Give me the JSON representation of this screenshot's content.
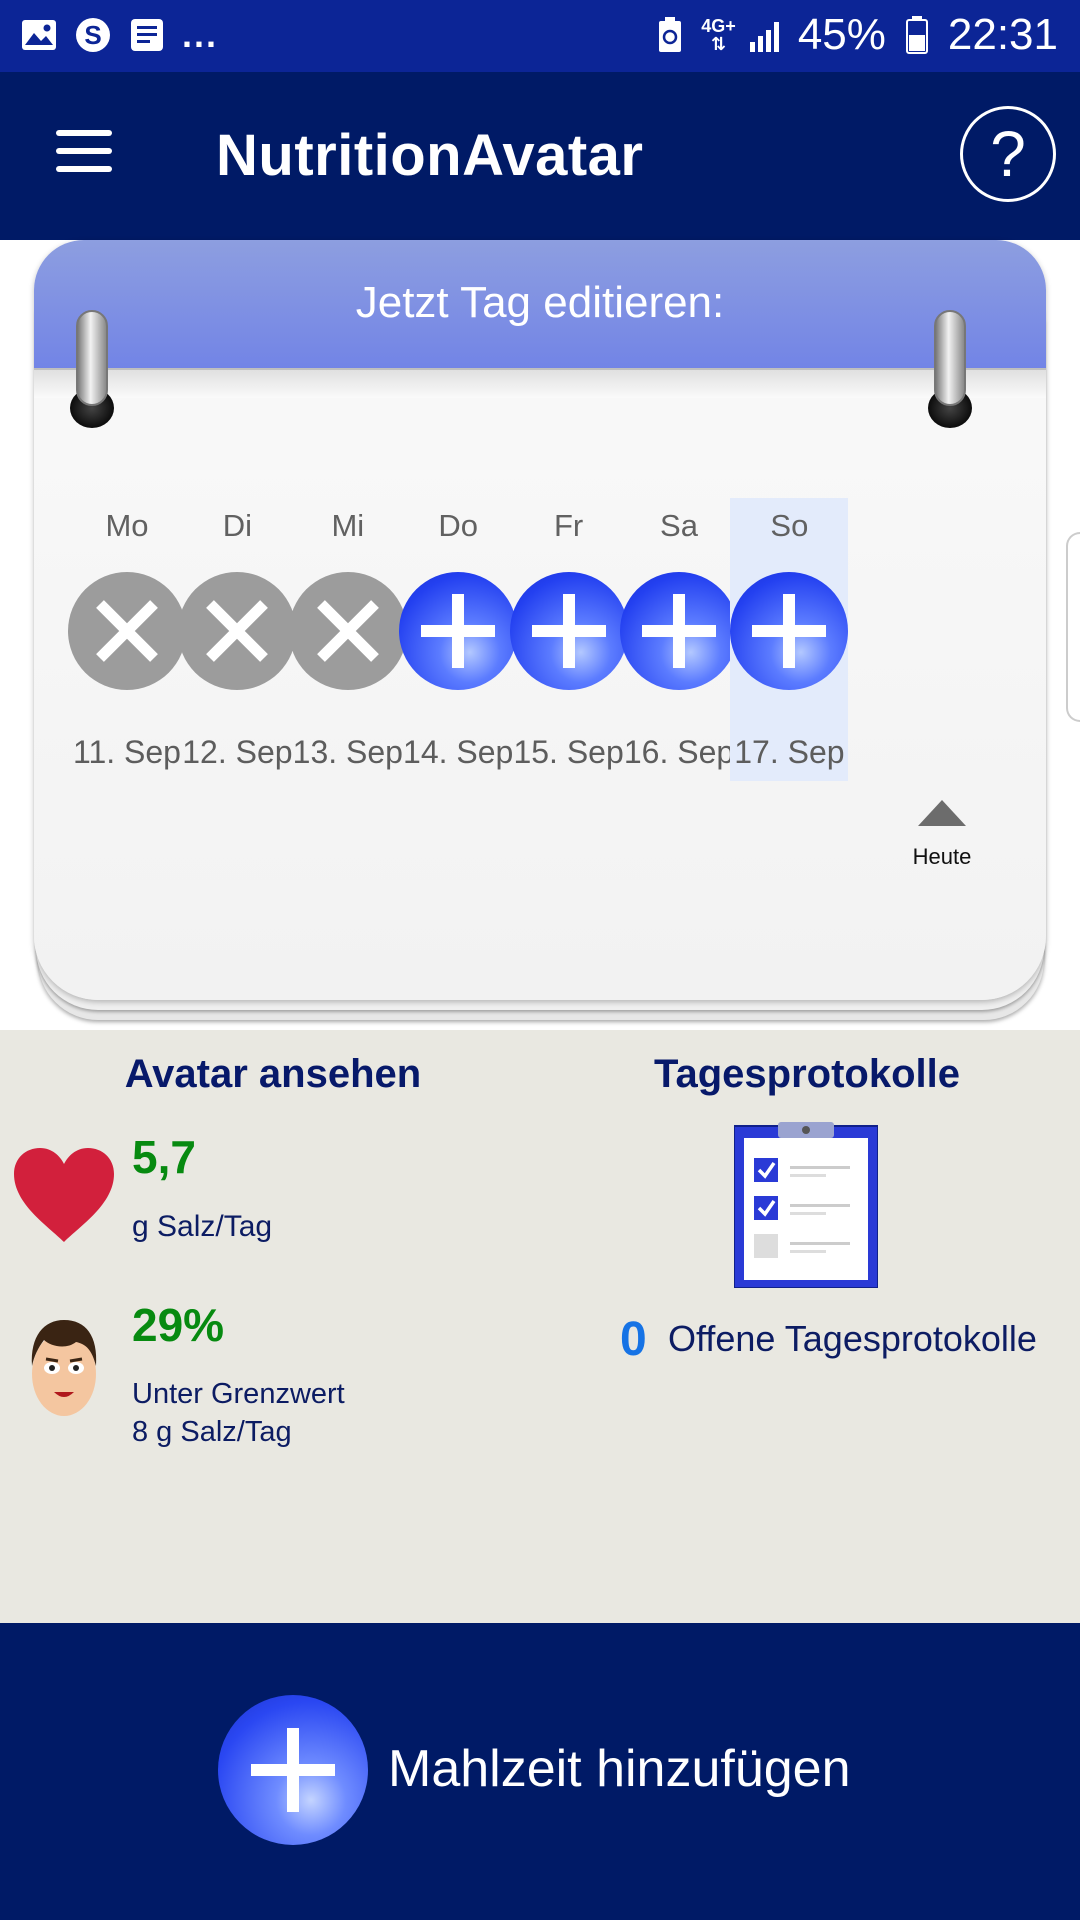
{
  "status_bar": {
    "notification_icons": [
      "image-icon",
      "skype-icon",
      "news-icon"
    ],
    "overflow": "...",
    "network": "4G+",
    "battery": "45%",
    "time": "22:31"
  },
  "app_bar": {
    "title": "NutritionAvatar",
    "help_label": "?"
  },
  "calendar": {
    "header": "Jetzt Tag editieren:",
    "days": [
      {
        "name": "Mo",
        "date": "11. Sep",
        "state": "past"
      },
      {
        "name": "Di",
        "date": "12. Sep",
        "state": "past"
      },
      {
        "name": "Mi",
        "date": "13. Sep",
        "state": "past"
      },
      {
        "name": "Do",
        "date": "14. Sep",
        "state": "future"
      },
      {
        "name": "Fr",
        "date": "15. Sep",
        "state": "future"
      },
      {
        "name": "Sa",
        "date": "16. Sep",
        "state": "future"
      },
      {
        "name": "So",
        "date": "17. Sep",
        "state": "today"
      }
    ],
    "today_label": "Heute"
  },
  "avatar_section": {
    "title": "Avatar ansehen",
    "salt_value": "5,7",
    "salt_unit": "g Salz/Tag",
    "percent": "29%",
    "limit_line1": "Unter Grenzwert",
    "limit_line2": "8 g Salz/Tag"
  },
  "protocols_section": {
    "title": "Tagesprotokolle",
    "open_count": "0",
    "open_label": "Offene Tagesprotokolle"
  },
  "bottom_bar": {
    "add_meal_label": "Mahlzeit hinzufügen"
  },
  "colors": {
    "status_bar": "#0c2596",
    "app_bar": "#001a66",
    "accent_blue": "#2340f0",
    "value_green": "#078a10",
    "heart_red": "#d2203c",
    "count_blue": "#1673e5"
  }
}
